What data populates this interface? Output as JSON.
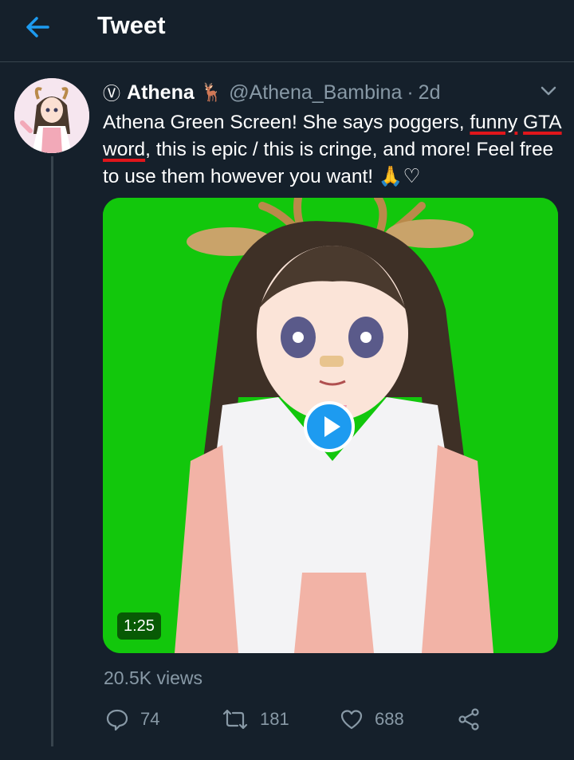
{
  "header": {
    "back_icon": "arrow-left-icon",
    "title": "Tweet"
  },
  "tweet": {
    "avatar_icon": "anime-avatar",
    "verified_glyph": "Ⓥ",
    "display_name": "Athena",
    "name_emoji": "🦌",
    "handle": "@Athena_Bambina",
    "separator": "·",
    "time": "2d",
    "text": {
      "part1": "Athena Green Screen! She says poggers, ",
      "underlined1": "funny",
      "space": " ",
      "underlined2": "GTA word",
      "part2": ", this is epic / this is cringe, and more! Feel free to use them however you want! 🙏♡"
    },
    "media": {
      "background_color": "#12c70c",
      "duration": "1:25",
      "play_icon": "play-icon"
    },
    "views": "20.5K views",
    "actions": {
      "reply_count": "74",
      "retweet_count": "181",
      "like_count": "688"
    }
  },
  "colors": {
    "background": "#15202b",
    "accent": "#1d9bf0",
    "secondary_text": "#8899a6",
    "underline_red": "#e0161b"
  }
}
